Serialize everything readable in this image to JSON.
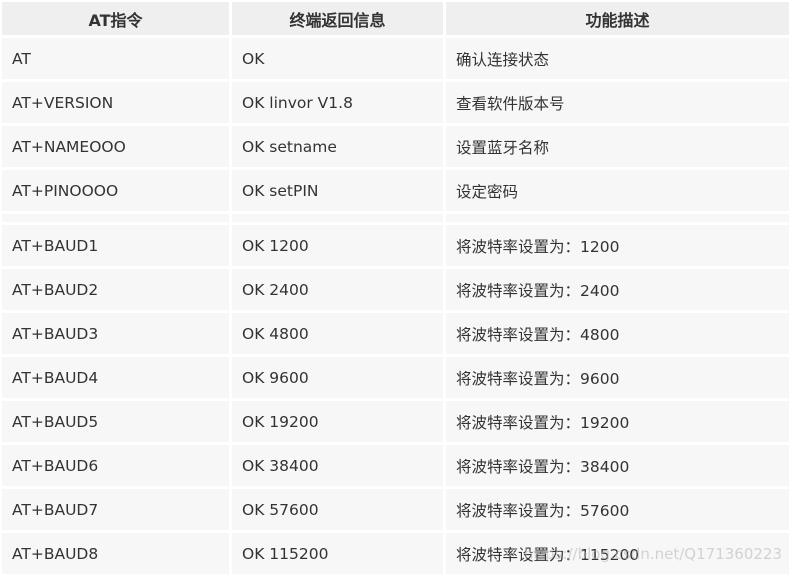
{
  "table": {
    "headers": [
      "AT指令",
      "终端返回信息",
      "功能描述"
    ],
    "rows_top": [
      {
        "cmd": "AT",
        "resp": "OK",
        "desc": "确认连接状态"
      },
      {
        "cmd": "AT+VERSION",
        "resp": "OK linvor V1.8",
        "desc": "查看软件版本号"
      },
      {
        "cmd": "AT+NAMEOOO",
        "resp": "OK setname",
        "desc": "设置蓝牙名称"
      },
      {
        "cmd": "AT+PINOOOO",
        "resp": "OK setPIN",
        "desc": "设定密码"
      }
    ],
    "rows_baud": [
      {
        "cmd": "AT+BAUD1",
        "resp": "OK 1200",
        "desc": "将波特率设置为：1200"
      },
      {
        "cmd": "AT+BAUD2",
        "resp": "OK 2400",
        "desc": "将波特率设置为：2400"
      },
      {
        "cmd": "AT+BAUD3",
        "resp": "OK 4800",
        "desc": "将波特率设置为：4800"
      },
      {
        "cmd": "AT+BAUD4",
        "resp": "OK 9600",
        "desc": "将波特率设置为：9600"
      },
      {
        "cmd": "AT+BAUD5",
        "resp": "OK 19200",
        "desc": "将波特率设置为：19200"
      },
      {
        "cmd": "AT+BAUD6",
        "resp": "OK 38400",
        "desc": "将波特率设置为：38400"
      },
      {
        "cmd": "AT+BAUD7",
        "resp": "OK 57600",
        "desc": "将波特率设置为：57600"
      },
      {
        "cmd": "AT+BAUD8",
        "resp": "OK 115200",
        "desc": "将波特率设置为：115200"
      }
    ]
  },
  "watermark": "https://blog.csdn.net/Q171360223",
  "colors": {
    "header_bg": "#efefef",
    "cell_bg": "#f7f7f7",
    "text": "#333333"
  }
}
